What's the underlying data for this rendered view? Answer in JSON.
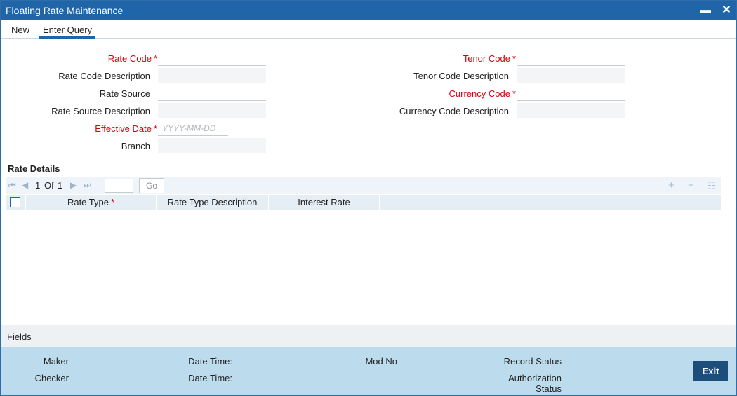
{
  "window": {
    "title": "Floating Rate Maintenance",
    "minimize_glyph": "▬",
    "close_glyph": "✕"
  },
  "menu": {
    "new": "New",
    "enter_query": "Enter Query"
  },
  "form": {
    "rate_code": {
      "label": "Rate Code",
      "required": "*"
    },
    "rate_code_desc": {
      "label": "Rate Code Description"
    },
    "rate_source": {
      "label": "Rate Source"
    },
    "rate_source_desc": {
      "label": "Rate Source Description"
    },
    "effective_date": {
      "label": "Effective Date",
      "required": "*",
      "placeholder": "YYYY-MM-DD"
    },
    "branch": {
      "label": "Branch"
    },
    "tenor_code": {
      "label": "Tenor Code",
      "required": "*"
    },
    "tenor_code_desc": {
      "label": "Tenor Code Description"
    },
    "currency_code": {
      "label": "Currency Code",
      "required": "*"
    },
    "currency_code_desc": {
      "label": "Currency Code Description"
    }
  },
  "rate_details": {
    "title": "Rate Details",
    "pager": {
      "current": "1",
      "of_label": "Of",
      "total": "1",
      "go_label": "Go"
    },
    "columns": [
      {
        "label": "Rate Type",
        "required": "*"
      },
      {
        "label": "Rate Type Description"
      },
      {
        "label": "Interest Rate"
      }
    ],
    "tools": {
      "add": "+",
      "remove": "−",
      "view": "☷"
    }
  },
  "fields_bar": {
    "label": "Fields"
  },
  "footer": {
    "maker": "Maker",
    "checker": "Checker",
    "date_time_1": "Date Time:",
    "date_time_2": "Date Time:",
    "mod_no": "Mod No",
    "record_status": "Record Status",
    "authorization_status_1": "Authorization",
    "authorization_status_2": "Status",
    "exit": "Exit"
  },
  "colors": {
    "titlebar": "#1f65a8",
    "required": "#d9000d",
    "footer": "#bcdcee",
    "exit_button": "#1c4e7c"
  }
}
